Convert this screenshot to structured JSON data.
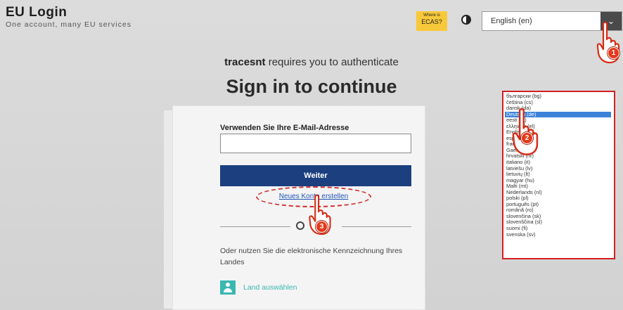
{
  "header": {
    "title": "EU Login",
    "subtitle": "One account, many EU services",
    "ecas_small": "Where is",
    "ecas_label": "ECAS?",
    "language": "English (en)"
  },
  "main": {
    "app_name": "tracesnt",
    "requires_text": " requires you to authenticate",
    "heading": "Sign in to continue"
  },
  "form": {
    "email_label": "Verwenden Sie Ihre E-Mail-Adresse",
    "email_value": "",
    "next_button": "Weiter",
    "new_account_link": "Neues Konto erstellen",
    "eid_text": "Oder nutzen Sie die elektronische Kennzeichnung Ihres Landes",
    "country_link": "Land auswählen"
  },
  "language_list": [
    "български (bg)",
    "čeština (cs)",
    "dansk (da)",
    "Deutsch (de)",
    "eesti (et)",
    "ελληνικά (el)",
    "English (en)",
    "español (es)",
    "français (fr)",
    "Gaeilge (ga)",
    "hrvatski (hr)",
    "italiano (it)",
    "latviešu (lv)",
    "lietuvių (lt)",
    "magyar (hu)",
    "Malti (mt)",
    "Nederlands (nl)",
    "polski (pl)",
    "português (pt)",
    "română (ro)",
    "slovenčina (sk)",
    "slovenščina (sl)",
    "suomi (fi)",
    "svenska (sv)"
  ],
  "selected_language_index": 3,
  "steps": [
    "1",
    "2",
    "3"
  ],
  "colors": {
    "primary_button": "#1b3f7f",
    "highlight_border": "#d41f1f",
    "ecas_badge": "#f7c93a",
    "country_accent": "#3bb7b1",
    "link": "#1f54b6",
    "selection": "#3b82d9"
  },
  "icons": {
    "contrast": "contrast-icon",
    "dropdown": "chevron-down-icon",
    "country": "user-card-icon",
    "pointer": "pointing-hand-icon"
  }
}
